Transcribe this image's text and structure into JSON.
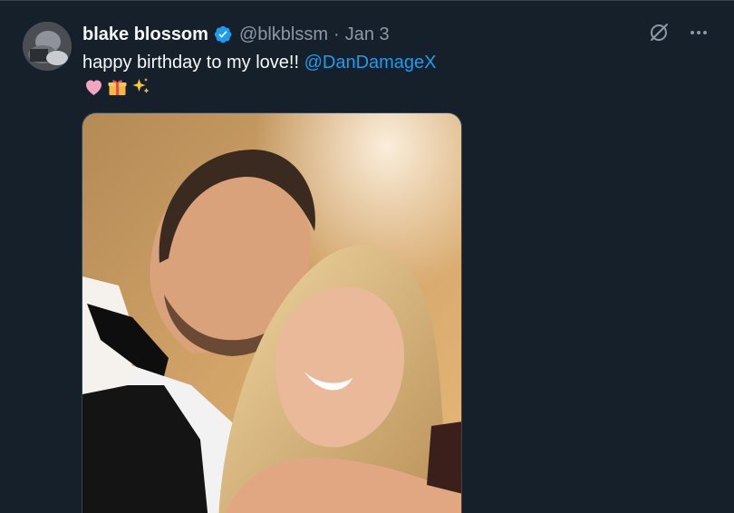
{
  "tweet": {
    "display_name": "blake blossom",
    "handle": "@blkblssm",
    "separator": "·",
    "date": "Jan 3",
    "text": "happy birthday to my love!! ",
    "mention": "@DanDamageX",
    "emojis": [
      "heart-icon",
      "gift-icon",
      "sparkles-icon"
    ]
  },
  "icons": {
    "verified": "verified-badge-icon",
    "grok": "grok-icon",
    "more": "more-icon"
  },
  "colors": {
    "background": "#15202b",
    "text": "#f7f9f9",
    "secondary": "#8b98a5",
    "accent": "#1d9bf0"
  }
}
